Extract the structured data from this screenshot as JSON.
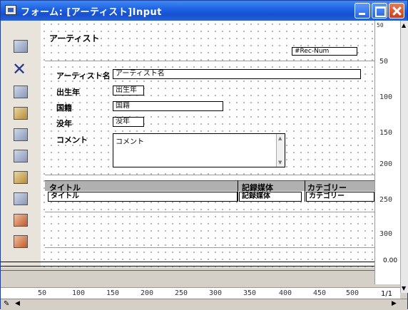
{
  "window": {
    "title": "フォーム: [アーティスト]Input"
  },
  "form": {
    "heading": "アーティスト",
    "rec_num_field": "#Rec-Num",
    "fields": [
      {
        "label": "アーティスト名",
        "value": "アーティスト名"
      },
      {
        "label": "出生年",
        "value": "出生年"
      },
      {
        "label": "国籍",
        "value": "国籍"
      },
      {
        "label": "没年",
        "value": "没年"
      },
      {
        "label": "コメント",
        "value": "コメント"
      }
    ],
    "subtable": {
      "headers": [
        "タイトル",
        "記録媒体",
        "カテゴリー"
      ],
      "row": [
        "タイトル",
        "記録媒体",
        "カテゴリー"
      ]
    }
  },
  "ruler_vertical": [
    "50",
    "100",
    "150",
    "200",
    "250",
    "300"
  ],
  "ruler_vertical_top": "50",
  "ruler_horizontal": [
    "50",
    "100",
    "150",
    "200",
    "250",
    "300",
    "350",
    "400",
    "450",
    "500"
  ],
  "page_indicator": "1/1",
  "corner_marker": "0.00",
  "icons": {
    "toolbar": [
      "form-icon",
      "delete-icon",
      "object-icon-1",
      "object-icon-2",
      "object-icon-3",
      "object-icon-4",
      "object-icon-5",
      "object-icon-6",
      "object-icon-7",
      "object-icon-8"
    ]
  }
}
